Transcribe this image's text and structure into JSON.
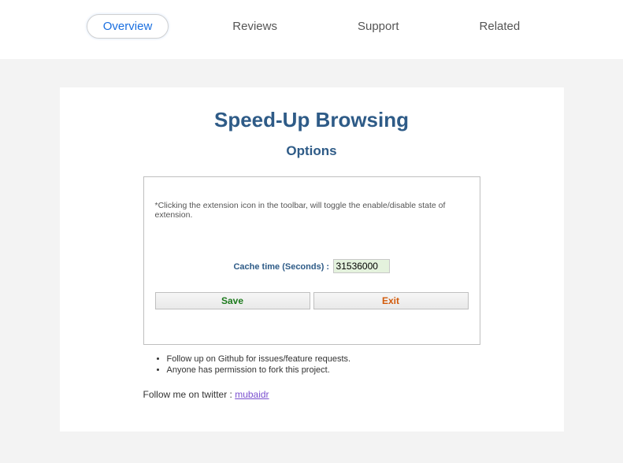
{
  "tabs": {
    "overview": "Overview",
    "reviews": "Reviews",
    "support": "Support",
    "related": "Related"
  },
  "page": {
    "title": "Speed-Up Browsing",
    "subtitle": "Options",
    "hint": "*Clicking the extension icon in the toolbar, will toggle the enable/disable state of extension.",
    "cache_label": "Cache time (Seconds) :",
    "cache_value": "31536000",
    "save_label": "Save",
    "exit_label": "Exit",
    "note1": "Follow up on Github for issues/feature requests.",
    "note2": "Anyone has permission to fork this project.",
    "follow_text": "Follow me on twitter : ",
    "follow_link": "mubaidr"
  }
}
